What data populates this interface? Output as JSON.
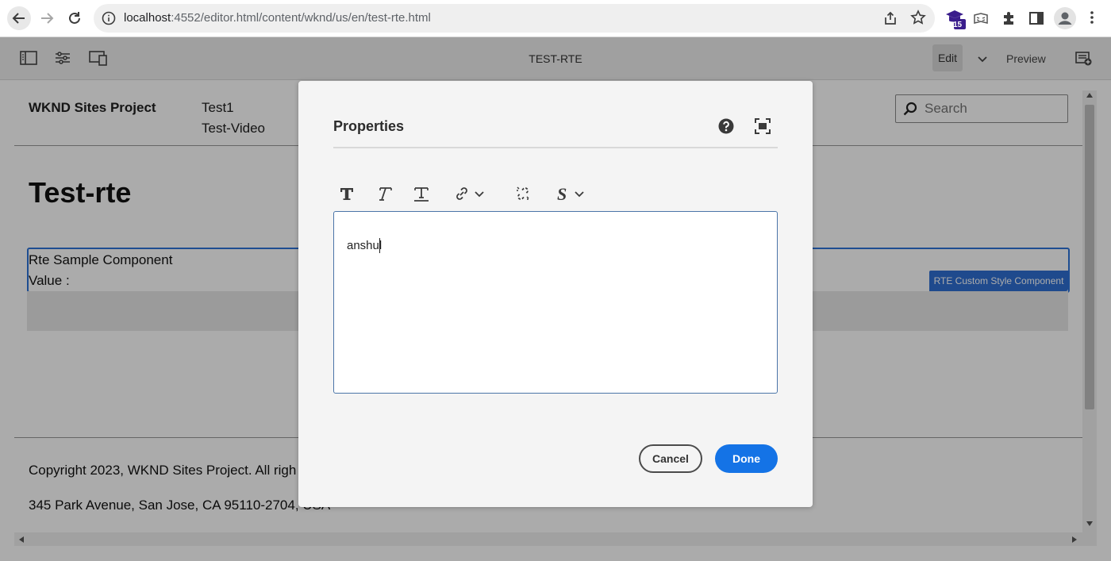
{
  "browser": {
    "url_host": "localhost",
    "url_path": ":4552/editor.html/content/wknd/us/en/test-rte.html",
    "extension_badge": "15",
    "icons": [
      "back-arrow-icon",
      "forward-arrow-icon",
      "reload-icon",
      "site-info-icon",
      "share-icon",
      "bookmark-star-icon",
      "extension-cap-icon",
      "extension-reader-icon",
      "puzzle-icon",
      "side-panel-icon",
      "profile-icon",
      "kebab-menu-icon"
    ]
  },
  "editor": {
    "page_name": "TEST-RTE",
    "mode_edit": "Edit",
    "mode_preview": "Preview",
    "icons": [
      "side-panel-toggle-icon",
      "page-properties-icon",
      "emulator-icon",
      "mode-chevron-icon",
      "annotations-icon"
    ]
  },
  "page": {
    "brand": "WKND Sites Project",
    "nav": [
      "Test1",
      "Test-Video"
    ],
    "search_placeholder": "Search",
    "title": "Test-rte",
    "component_line1": "Rte Sample Component",
    "component_line2": "Value :",
    "component_badge": "RTE Custom Style Component",
    "footer_copyright": "Copyright 2023, WKND Sites Project. All righ",
    "footer_address": "345 Park Avenue, San Jose, CA 95110-2704, USA"
  },
  "dialog": {
    "title": "Properties",
    "rte_value": "anshul",
    "cancel_label": "Cancel",
    "done_label": "Done",
    "toolbar_icons": [
      "bold-icon",
      "italic-icon",
      "underline-icon",
      "link-icon",
      "unlink-icon",
      "style-icon"
    ]
  },
  "colors": {
    "accent": "#1473e6",
    "selection_outline": "#2d74d9",
    "badge": "#2f6fd3"
  }
}
